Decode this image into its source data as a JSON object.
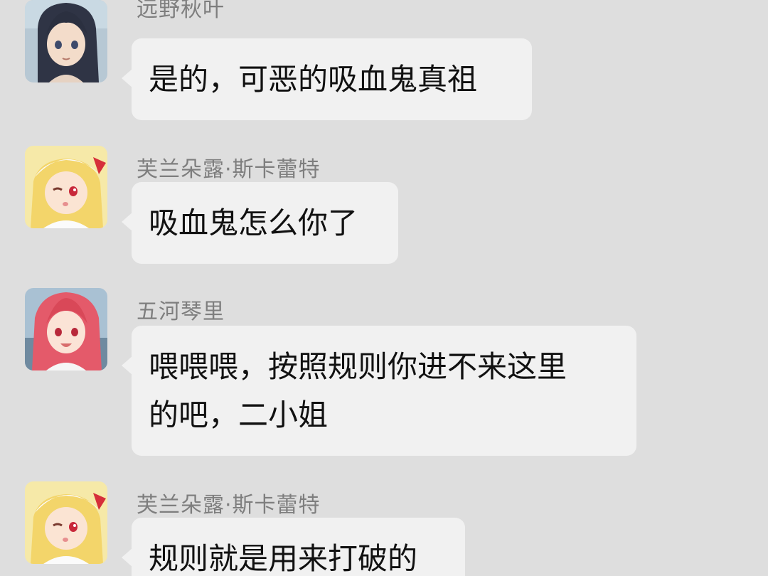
{
  "messages": [
    {
      "sender": "远野秋叶",
      "lines": [
        "是的，可恶的吸血鬼真祖"
      ],
      "avatar": "avatar-dark-hair-girl"
    },
    {
      "sender": "芙兰朵露·斯卡蕾特",
      "lines": [
        "吸血鬼怎么你了"
      ],
      "avatar": "avatar-blonde-girl-winking"
    },
    {
      "sender": "五河琴里",
      "lines": [
        "喂喂喂，按照规则你进不来这里",
        "的吧，二小姐"
      ],
      "avatar": "avatar-red-hair-girl"
    },
    {
      "sender": "芙兰朵露·斯卡蕾特",
      "lines": [
        "规则就是用来打破的"
      ],
      "avatar": "avatar-blonde-girl-winking"
    }
  ],
  "colors": {
    "background": "#dedede",
    "bubble": "#f1f1f1",
    "sender_text": "#7e7e7e",
    "message_text": "#111111"
  }
}
